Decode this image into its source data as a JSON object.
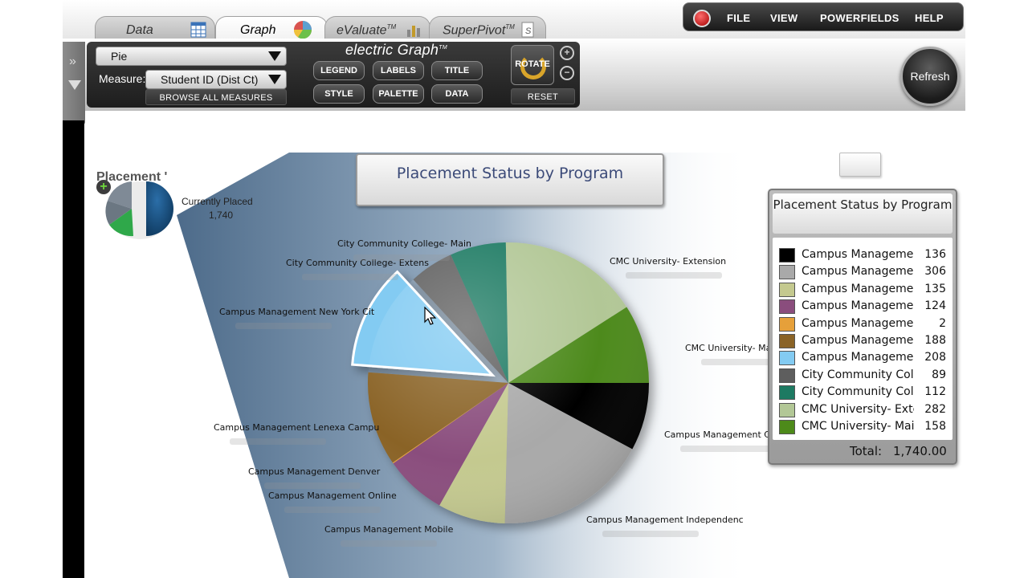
{
  "tabs": [
    {
      "label": "Data",
      "icon": "table-icon"
    },
    {
      "label": "Graph",
      "icon": "pie-icon",
      "active": true
    },
    {
      "label": "eValuate",
      "superscript": "TM",
      "icon": "bar-icon"
    },
    {
      "label": "SuperPivot",
      "superscript": "TM",
      "icon": "sheet-icon"
    }
  ],
  "menu": {
    "logo_icon": "app-logo-icon",
    "items": [
      "FILE",
      "VIEW",
      "POWERFIELDS",
      "HELP"
    ]
  },
  "toolbar": {
    "chart_type": "Pie",
    "measure_label": "Measure:",
    "measure_value": "Student ID (Dist Ct)",
    "browse_label": "BROWSE ALL MEASURES",
    "brand": "electric Graph",
    "brand_tm": "TM",
    "buttons": [
      "LEGEND",
      "LABELS",
      "TITLE",
      "STYLE",
      "PALETTE",
      "DATA"
    ],
    "rotate_label": "ROTATE",
    "reset_label": "RESET",
    "refresh_label": "Refresh"
  },
  "mini": {
    "title": "Placement '",
    "label": "Currently Placed",
    "value": "1,740"
  },
  "chart_data": {
    "type": "pie",
    "title": "Placement Status by Program",
    "categories": [
      "Campus Management Cu",
      "Campus Management Independenc",
      "Campus Management Mobile",
      "Campus Management Online",
      "Campus Management Denver",
      "Campus Management Lenexa Campu",
      "Campus Management New York Cit",
      "City Community College- Extens",
      "City Community College- Main",
      "CMC University- Extension",
      "CMC University- Main"
    ],
    "values": [
      136,
      306,
      135,
      124,
      2,
      188,
      208,
      89,
      112,
      282,
      158
    ],
    "colors": [
      "#000000",
      "#a9a9a9",
      "#c4c98f",
      "#8a4d7d",
      "#e6a03a",
      "#8a6326",
      "#83cbf2",
      "#5e5e5e",
      "#1d7a62",
      "#b2c796",
      "#4d8a1a"
    ],
    "exploded_index": 6,
    "legend_title": "Placement Status by Program",
    "legend_names": [
      "Campus Management",
      "Campus Management",
      "Campus Management",
      "Campus Management",
      "Campus Management D",
      "Campus Management",
      "Campus Management",
      "City Community Colleg",
      "City Community Colle",
      "CMC University- Exte",
      "CMC University- Main"
    ],
    "total_label": "Total:",
    "total_value": "1,740.00"
  }
}
